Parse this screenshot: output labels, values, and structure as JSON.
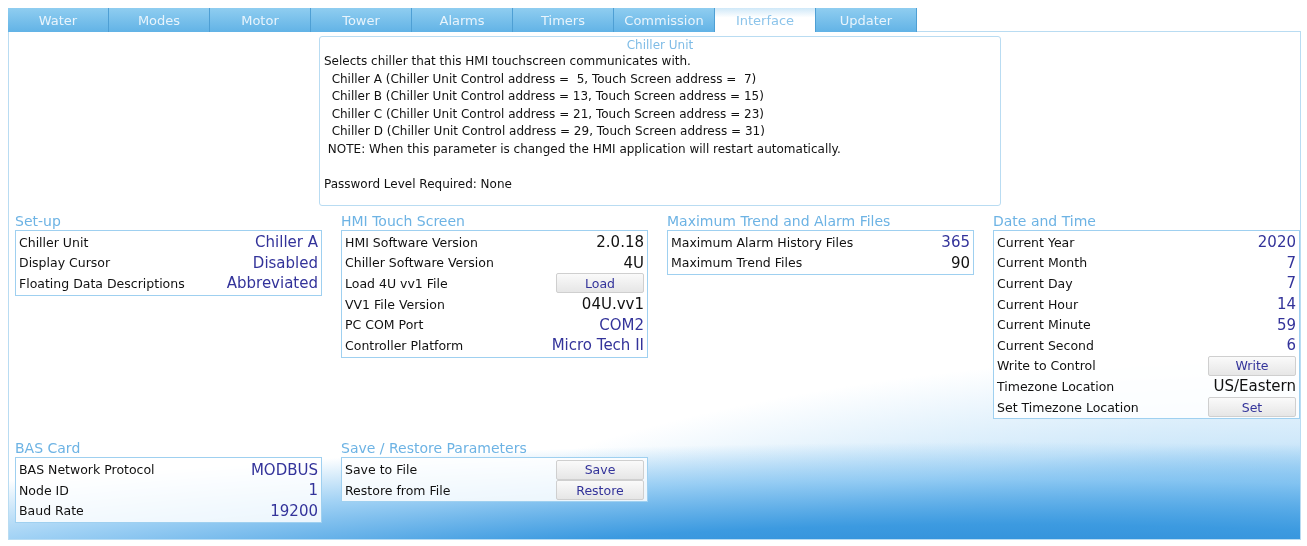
{
  "tabs": [
    {
      "label": "Water",
      "selected": false
    },
    {
      "label": "Modes",
      "selected": false
    },
    {
      "label": "Motor",
      "selected": false
    },
    {
      "label": "Tower",
      "selected": false
    },
    {
      "label": "Alarms",
      "selected": false
    },
    {
      "label": "Timers",
      "selected": false
    },
    {
      "label": "Commission",
      "selected": false
    },
    {
      "label": "Interface",
      "selected": true
    },
    {
      "label": "Updater",
      "selected": false
    }
  ],
  "help": {
    "title": "Chiller Unit",
    "lines": [
      "Selects chiller that this HMI touchscreen communicates with.",
      "  Chiller A (Chiller Unit Control address =  5, Touch Screen address =  7)",
      "  Chiller B (Chiller Unit Control address = 13, Touch Screen address = 15)",
      "  Chiller C (Chiller Unit Control address = 21, Touch Screen address = 23)",
      "  Chiller D (Chiller Unit Control address = 29, Touch Screen address = 31)",
      " NOTE: When this parameter is changed the HMI application will restart automatically."
    ],
    "footer": "Password Level Required: None"
  },
  "panels": [
    {
      "title": "Set-up",
      "rows": [
        {
          "label": "Chiller Unit",
          "kind": "setting",
          "value": "Chiller A"
        },
        {
          "label": "Display Cursor",
          "kind": "setting",
          "value": "Disabled"
        },
        {
          "label": "Floating Data Descriptions",
          "kind": "setting",
          "value": "Abbreviated"
        }
      ]
    },
    {
      "title": "HMI Touch Screen",
      "rows": [
        {
          "label": "HMI Software Version",
          "kind": "readout",
          "value": "2.0.18"
        },
        {
          "label": "Chiller Software Version",
          "kind": "readout",
          "value": "4U"
        },
        {
          "label": "Load 4U vv1 File",
          "kind": "button",
          "value": "Load"
        },
        {
          "label": "VV1 File Version",
          "kind": "readout",
          "value": "04U.vv1"
        },
        {
          "label": "PC COM Port",
          "kind": "setting",
          "value": "COM2"
        },
        {
          "label": "Controller Platform",
          "kind": "setting",
          "value": "Micro Tech II"
        }
      ]
    },
    {
      "title": "Maximum Trend and Alarm Files",
      "rows": [
        {
          "label": "Maximum Alarm History Files",
          "kind": "setting",
          "value": "365"
        },
        {
          "label": "Maximum Trend Files",
          "kind": "readout",
          "value": "90"
        }
      ]
    },
    {
      "title": "Date and Time",
      "rows": [
        {
          "label": "Current Year",
          "kind": "setting",
          "value": "2020"
        },
        {
          "label": "Current Month",
          "kind": "setting",
          "value": "7"
        },
        {
          "label": "Current Day",
          "kind": "setting",
          "value": "7"
        },
        {
          "label": "Current Hour",
          "kind": "setting",
          "value": "14"
        },
        {
          "label": "Current Minute",
          "kind": "setting",
          "value": "59"
        },
        {
          "label": "Current Second",
          "kind": "setting",
          "value": "6"
        },
        {
          "label": "Write to Control",
          "kind": "button",
          "value": "Write"
        },
        {
          "label": "Timezone Location",
          "kind": "readout",
          "value": "US/Eastern"
        },
        {
          "label": "Set Timezone Location",
          "kind": "button",
          "value": "Set"
        }
      ]
    },
    {
      "title": "BAS Card",
      "rows": [
        {
          "label": "BAS Network Protocol",
          "kind": "setting",
          "value": "MODBUS"
        },
        {
          "label": "Node ID",
          "kind": "setting",
          "value": "1"
        },
        {
          "label": "Baud Rate",
          "kind": "setting",
          "value": "19200"
        }
      ]
    },
    {
      "title": "Save / Restore Parameters",
      "rows": [
        {
          "label": "Save to File",
          "kind": "button",
          "value": "Save"
        },
        {
          "label": "Restore from File",
          "kind": "button",
          "value": "Restore"
        }
      ]
    }
  ]
}
